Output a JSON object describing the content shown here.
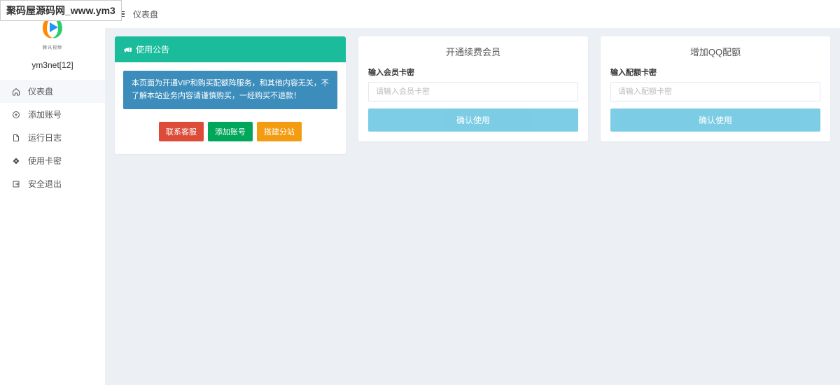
{
  "browser": {
    "tab_title": "聚码屋源码网_www.ym3"
  },
  "sidebar": {
    "logo_sub": "腾讯视频",
    "username": "ym3net[12]",
    "items": [
      {
        "label": "仪表盘"
      },
      {
        "label": "添加账号"
      },
      {
        "label": "运行日志"
      },
      {
        "label": "使用卡密"
      },
      {
        "label": "安全退出"
      }
    ]
  },
  "header": {
    "title": "仪表盘"
  },
  "announce": {
    "header": "使用公告",
    "alert": "本页面为开通VIP和购买配额阵服务，和其他内容无关，不了解本站业务内容请谨慎购买，一经购买不退款！",
    "buttons": {
      "contact": "联系客服",
      "add_account": "添加账号",
      "build_site": "搭建分站"
    }
  },
  "vip": {
    "header": "开通续费会员",
    "label": "输入会员卡密",
    "placeholder": "请输入会员卡密",
    "confirm": "确认使用"
  },
  "quota": {
    "header": "增加QQ配额",
    "label": "输入配额卡密",
    "placeholder": "请输入配额卡密",
    "confirm": "确认使用"
  }
}
